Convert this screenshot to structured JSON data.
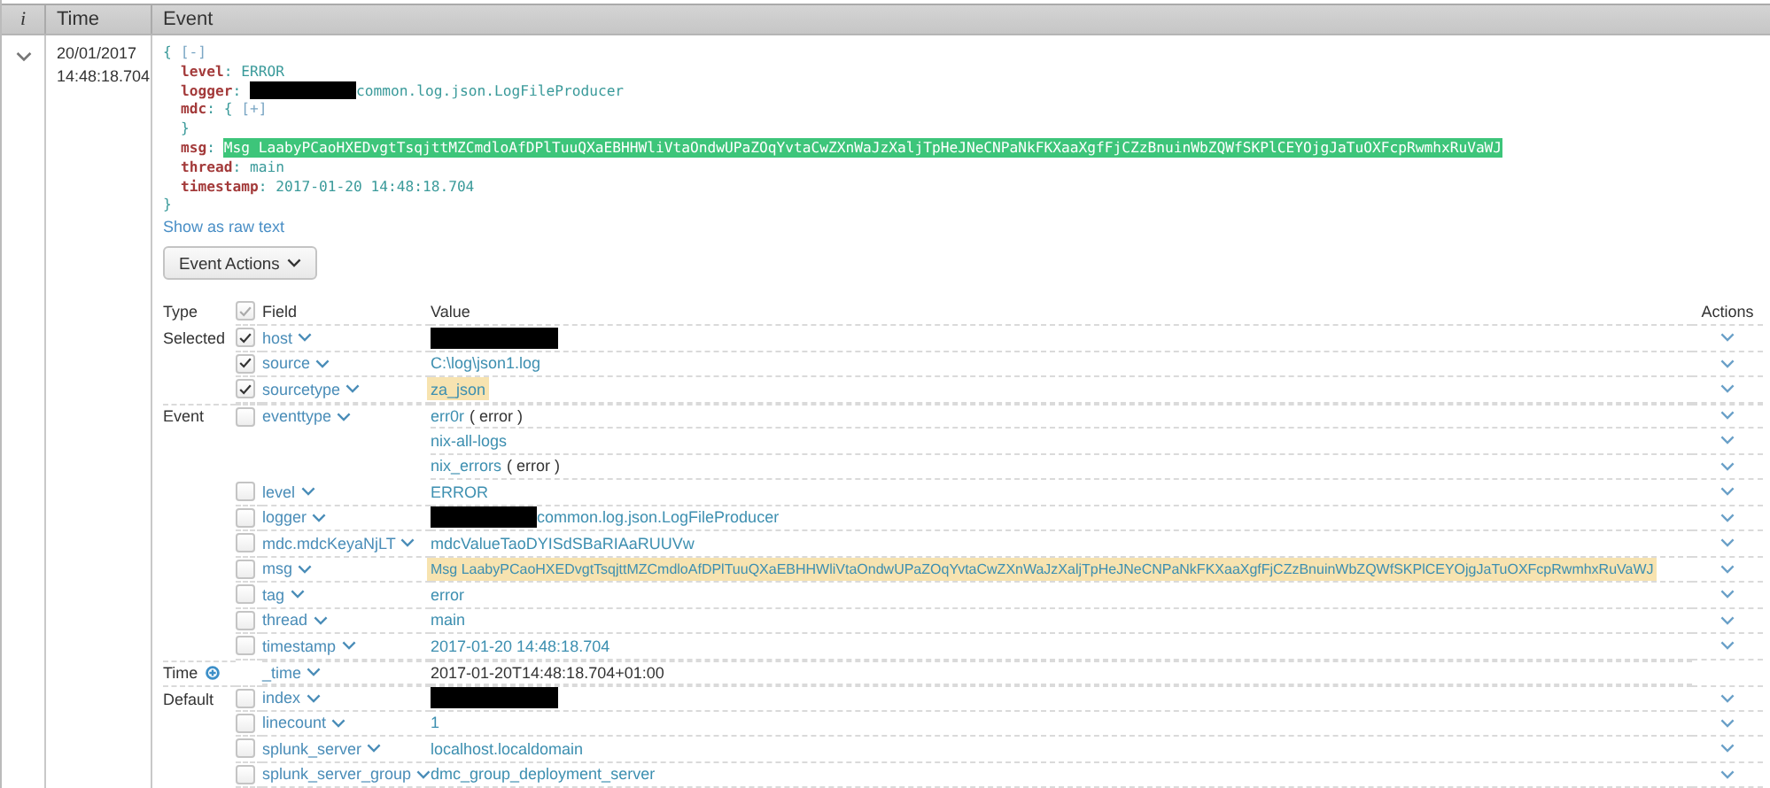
{
  "header": {
    "info": "i",
    "time": "Time",
    "event": "Event"
  },
  "event": {
    "expanded": true,
    "time_lines": [
      "20/01/2017",
      "14:48:18.704"
    ],
    "json": {
      "open": "{",
      "toggle": "[-]",
      "separator": ":",
      "close": "}",
      "fields": [
        {
          "kind": "value",
          "key": "level",
          "value": "ERROR"
        },
        {
          "kind": "value",
          "key": "logger",
          "redacted": true,
          "value": "common.log.json.LogFileProducer"
        },
        {
          "kind": "object",
          "key": "mdc",
          "open": "{",
          "toggle": "[+]",
          "close": "}"
        },
        {
          "kind": "value",
          "key": "msg",
          "value": "Msg LaabyPCaoHXEDvgtTsqjttMZCmdloAfDPlTuuQXaEBHHWliVtaOndwUPaZOqYvtaCwZXnWaJzXaljTpHeJNeCNPaNkFKXaaXgfFjCZzBnuinWbZQWfSKPlCEYOjgJaTuOXFcpRwmhxRuVaWJ",
          "highlighted": true
        },
        {
          "kind": "value",
          "key": "thread",
          "value": "main"
        },
        {
          "kind": "value",
          "key": "timestamp",
          "value": "2017-01-20 14:48:18.704"
        }
      ]
    },
    "raw_link": "Show as raw text",
    "actions_button": "Event Actions"
  },
  "fields_table": {
    "columns": {
      "type": "Type",
      "field": "Field",
      "value": "Value",
      "actions": "Actions"
    },
    "header_checked": true,
    "groups": [
      {
        "type": "Selected",
        "rows": [
          {
            "kind": "field",
            "field": "host",
            "checked": true,
            "values": [
              {
                "redacted": true
              }
            ]
          },
          {
            "kind": "field",
            "field": "source",
            "checked": true,
            "values": [
              {
                "text": "C:\\log\\json1.log"
              }
            ]
          },
          {
            "kind": "field",
            "field": "sourcetype",
            "checked": true,
            "values": [
              {
                "text": "za_json",
                "highlighted": true
              }
            ]
          }
        ]
      },
      {
        "type": "Event",
        "rows": [
          {
            "kind": "field",
            "field": "eventtype",
            "checked": false,
            "values": [
              {
                "text": "err0r",
                "tag": "( error )"
              },
              {
                "text": "nix-all-logs"
              },
              {
                "text": "nix_errors",
                "tag": "( error )"
              }
            ]
          },
          {
            "kind": "field",
            "field": "level",
            "checked": false,
            "values": [
              {
                "text": "ERROR"
              }
            ]
          },
          {
            "kind": "field",
            "field": "logger",
            "checked": false,
            "values": [
              {
                "redacted": true,
                "text": "common.log.json.LogFileProducer"
              }
            ]
          },
          {
            "kind": "field",
            "field": "mdc.mdcKeyaNjLT",
            "checked": false,
            "values": [
              {
                "text": "mdcValueTaoDYISdSBaRIAaRUUVw"
              }
            ]
          },
          {
            "kind": "field",
            "field": "msg",
            "checked": false,
            "values": [
              {
                "text": "Msg LaabyPCaoHXEDvgtTsqjttMZCmdloAfDPlTuuQXaEBHHWliVtaOndwUPaZOqYvtaCwZXnWaJzXaljTpHeJNeCNPaNkFKXaaXgfFjCZzBnuinWbZQWfSKPlCEYOjgJaTuOXFcpRwmhxRuVaWJ",
                "highlighted": true
              }
            ]
          },
          {
            "kind": "field",
            "field": "tag",
            "checked": false,
            "values": [
              {
                "text": "error"
              }
            ]
          },
          {
            "kind": "field",
            "field": "thread",
            "checked": false,
            "values": [
              {
                "text": "main"
              }
            ]
          },
          {
            "kind": "field",
            "field": "timestamp",
            "checked": false,
            "values": [
              {
                "text": "2017-01-20 14:48:18.704"
              }
            ]
          }
        ]
      },
      {
        "type": "Time",
        "type_icon": true,
        "rows": [
          {
            "kind": "time",
            "field": "_time",
            "values": [
              {
                "text": "2017-01-20T14:48:18.704+01:00"
              }
            ]
          }
        ]
      },
      {
        "type": "Default",
        "rows": [
          {
            "kind": "field",
            "field": "index",
            "checked": false,
            "values": [
              {
                "redacted": true
              }
            ]
          },
          {
            "kind": "field",
            "field": "linecount",
            "checked": false,
            "values": [
              {
                "text": "1"
              }
            ]
          },
          {
            "kind": "field",
            "field": "splunk_server",
            "checked": false,
            "values": [
              {
                "text": "localhost.localdomain"
              }
            ]
          },
          {
            "kind": "field",
            "field": "splunk_server_group",
            "checked": false,
            "values": [
              {
                "text": "dmc_group_deployment_server"
              }
            ]
          }
        ]
      }
    ]
  }
}
